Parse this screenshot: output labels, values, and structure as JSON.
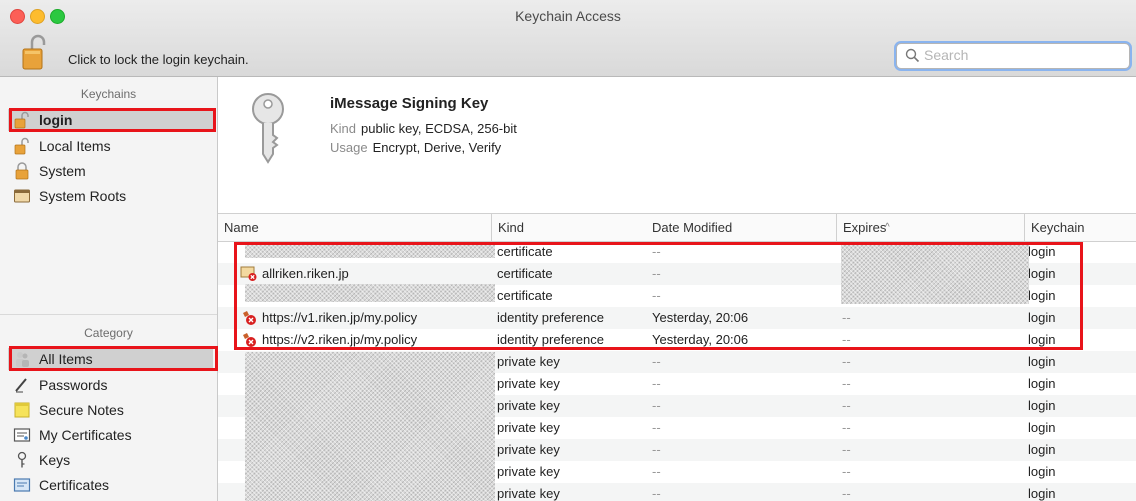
{
  "window": {
    "title": "Keychain Access"
  },
  "toolbar": {
    "lock_label": "Click to lock the login keychain."
  },
  "search": {
    "placeholder": "Search",
    "value": ""
  },
  "sidebar": {
    "keychains_header": "Keychains",
    "keychains": [
      {
        "label": "login",
        "icon": "unlocked-lock-icon",
        "selected": true
      },
      {
        "label": "Local Items",
        "icon": "unlocked-lock-icon"
      },
      {
        "label": "System",
        "icon": "locked-lock-icon"
      },
      {
        "label": "System Roots",
        "icon": "folder-icon"
      }
    ],
    "category_header": "Category",
    "categories": [
      {
        "label": "All Items",
        "icon": "people-icon",
        "selected": true
      },
      {
        "label": "Passwords",
        "icon": "password-pen-icon"
      },
      {
        "label": "Secure Notes",
        "icon": "note-icon"
      },
      {
        "label": "My Certificates",
        "icon": "certificate-icon"
      },
      {
        "label": "Keys",
        "icon": "key-icon"
      },
      {
        "label": "Certificates",
        "icon": "certificate-icon"
      }
    ]
  },
  "detail": {
    "title": "iMessage Signing Key",
    "kind_label": "Kind",
    "kind_value": "public key, ECDSA, 256-bit",
    "usage_label": "Usage",
    "usage_value": "Encrypt, Derive, Verify"
  },
  "table": {
    "columns": [
      "Name",
      "Kind",
      "Date Modified",
      "Expires",
      "Keychain"
    ],
    "sort_indicator": "^",
    "rows": [
      {
        "name": "",
        "kind": "certificate",
        "date": "--",
        "expires": "",
        "keychain": "login"
      },
      {
        "name": "allriken.riken.jp",
        "kind": "certificate",
        "date": "--",
        "expires": "",
        "keychain": "login",
        "icon": "certificate-error-icon"
      },
      {
        "name": "",
        "kind": "certificate",
        "date": "--",
        "expires": "",
        "keychain": "login"
      },
      {
        "name": "https://v1.riken.jp/my.policy",
        "kind": "identity preference",
        "date": "Yesterday, 20:06",
        "expires": "--",
        "keychain": "login",
        "icon": "identity-pref-icon"
      },
      {
        "name": "https://v2.riken.jp/my.policy",
        "kind": "identity preference",
        "date": "Yesterday, 20:06",
        "expires": "--",
        "keychain": "login",
        "icon": "identity-pref-icon"
      },
      {
        "name": "",
        "kind": "private key",
        "date": "--",
        "expires": "--",
        "keychain": "login"
      },
      {
        "name": "",
        "kind": "private key",
        "date": "--",
        "expires": "--",
        "keychain": "login"
      },
      {
        "name": "",
        "kind": "private key",
        "date": "--",
        "expires": "--",
        "keychain": "login"
      },
      {
        "name": "",
        "kind": "private key",
        "date": "--",
        "expires": "--",
        "keychain": "login"
      },
      {
        "name": "",
        "kind": "private key",
        "date": "--",
        "expires": "--",
        "keychain": "login"
      },
      {
        "name": "",
        "kind": "private key",
        "date": "--",
        "expires": "--",
        "keychain": "login"
      },
      {
        "name": "",
        "kind": "private key",
        "date": "--",
        "expires": "--",
        "keychain": "login"
      }
    ]
  },
  "colors": {
    "annotation_red": "#e8141a",
    "selection_gray": "#d0d0d0"
  }
}
